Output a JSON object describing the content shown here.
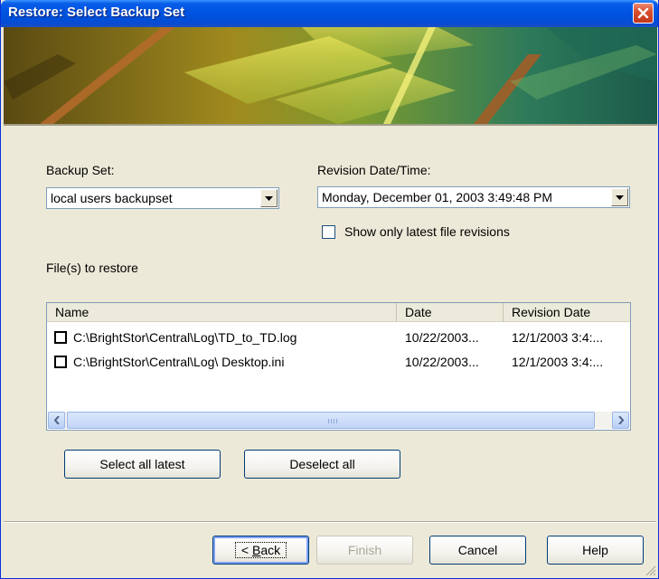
{
  "window": {
    "title": "Restore: Select Backup Set",
    "colors": {
      "titlebar": "#0054e3",
      "dialog_bg": "#ece9d8",
      "close": "#d9512f"
    }
  },
  "backup_set": {
    "label": "Backup Set:",
    "selected": "local users backupset"
  },
  "revision": {
    "label": "Revision Date/Time:",
    "selected": "Monday, December 01, 2003 3:49:48 PM"
  },
  "latest_only": {
    "label": "Show only latest file revisions",
    "checked": false
  },
  "files_section_label": "File(s) to restore",
  "file_list": {
    "columns": [
      "Name",
      "Date",
      "Revision Date"
    ],
    "rows": [
      {
        "name": "C:\\BrightStor\\Central\\Log\\TD_to_TD.log",
        "date": "10/22/2003...",
        "revision_date": "12/1/2003 3:4:...",
        "checked": false
      },
      {
        "name": "C:\\BrightStor\\Central\\Log\\ Desktop.ini",
        "date": "10/22/2003...",
        "revision_date": "12/1/2003 3:4:...",
        "checked": false
      }
    ]
  },
  "list_buttons": {
    "select_latest": "Select all latest",
    "deselect_all": "Deselect all"
  },
  "footer_buttons": {
    "back": "< Back",
    "finish": "Finish",
    "cancel": "Cancel",
    "help": "Help"
  }
}
